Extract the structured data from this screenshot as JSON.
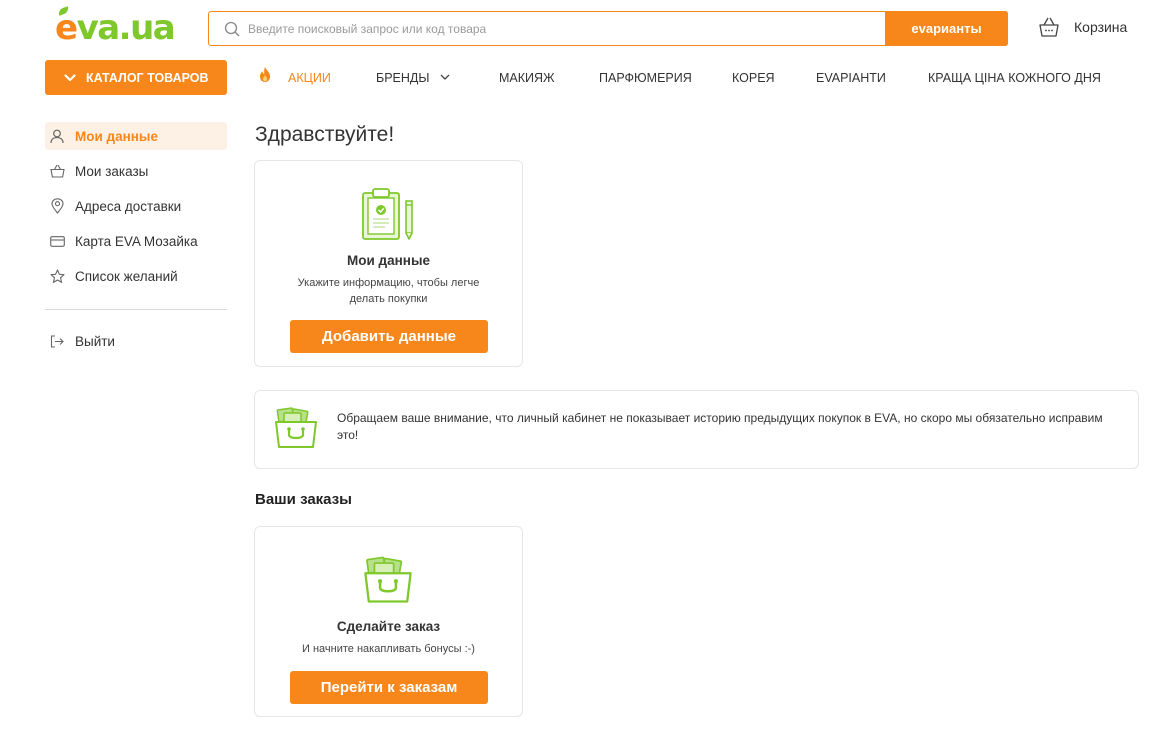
{
  "header": {
    "logo_e": "e",
    "logo_rest": "va.ua",
    "search_placeholder": "Введите поисковый запрос или код товара",
    "search_button": "evарианты",
    "cart_label": "Корзина"
  },
  "nav": {
    "catalog_label": "КАТАЛОГ ТОВАРОВ",
    "items": [
      "АКЦИИ",
      "БРЕНДЫ",
      "МАКИЯЖ",
      "ПАРФЮМЕРИЯ",
      "КОРЕЯ",
      "EVAPIАНТИ",
      "КРАЩА ЦІНА КОЖНОГО ДНЯ"
    ]
  },
  "sidebar": {
    "items": [
      {
        "label": "Мои данные",
        "icon": "user-icon",
        "active": true
      },
      {
        "label": "Мои заказы",
        "icon": "basket-icon"
      },
      {
        "label": "Адреса доставки",
        "icon": "location-pin-icon"
      },
      {
        "label": "Карта EVA Мозайка",
        "icon": "card-icon"
      },
      {
        "label": "Список желаний",
        "icon": "star-icon"
      }
    ],
    "logout": {
      "label": "Выйти",
      "icon": "logout-icon"
    }
  },
  "main": {
    "greeting": "Здравствуйте!",
    "data_card": {
      "title": "Мои данные",
      "text_line1": "Укажите информацию, чтобы легче",
      "text_line2": "делать покупки",
      "button": "Добавить данные",
      "icon": "clipboard-icon"
    },
    "notice": {
      "text": "Обращаем ваше внимание, что личный кабинет не показывает историю предыдущих покупок в EVA, но скоро мы обязательно исправим это!",
      "icon": "shopping-basket-icon"
    },
    "orders_title": "Ваши заказы",
    "orders_card": {
      "title": "Сделайте заказ",
      "text": "И начните накапливать бонусы :-)",
      "button": "Перейти к заказам",
      "icon": "shopping-basket-icon"
    }
  },
  "colors": {
    "accent": "#f7861b",
    "brand_green": "#7ec82b",
    "active_bg": "#fdf1e6"
  }
}
